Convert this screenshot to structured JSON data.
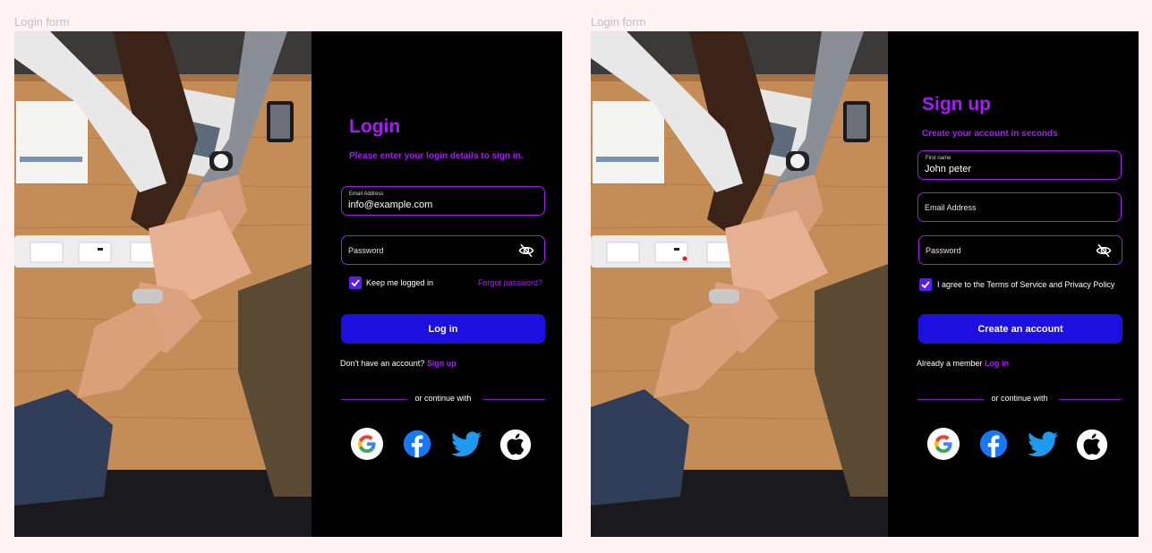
{
  "login": {
    "frame_label": "Login form",
    "title": "Login",
    "subtitle": "Please enter your login details to sign in.",
    "email": {
      "label": "Email Address",
      "value": "info@example.com"
    },
    "password": {
      "placeholder": "Password"
    },
    "remember_label": "Keep me logged in",
    "forgot_label": "Forgot password?",
    "submit_label": "Log in",
    "footer_text": "Don't have an account?",
    "footer_link": "Sign up",
    "divider_text": "or continue with"
  },
  "signup": {
    "frame_label": "Login form",
    "title": "Sign up",
    "subtitle": "Create your account in seconds",
    "first_name": {
      "label": "First name",
      "value": "John peter"
    },
    "email": {
      "placeholder": "Email Address"
    },
    "password": {
      "placeholder": "Password"
    },
    "agree_label": "I agree to the Terms of Service and Privacy Policy",
    "submit_label": "Create an account",
    "footer_text": "Already a member",
    "footer_link": "Log in",
    "divider_text": "or continue with"
  },
  "social_icons": [
    "google-icon",
    "facebook-icon",
    "twitter-icon",
    "apple-icon"
  ],
  "colors": {
    "accent": "#a31ef0",
    "button": "#1d0fe0",
    "panel": "#000000",
    "background": "#fdf3f3"
  }
}
